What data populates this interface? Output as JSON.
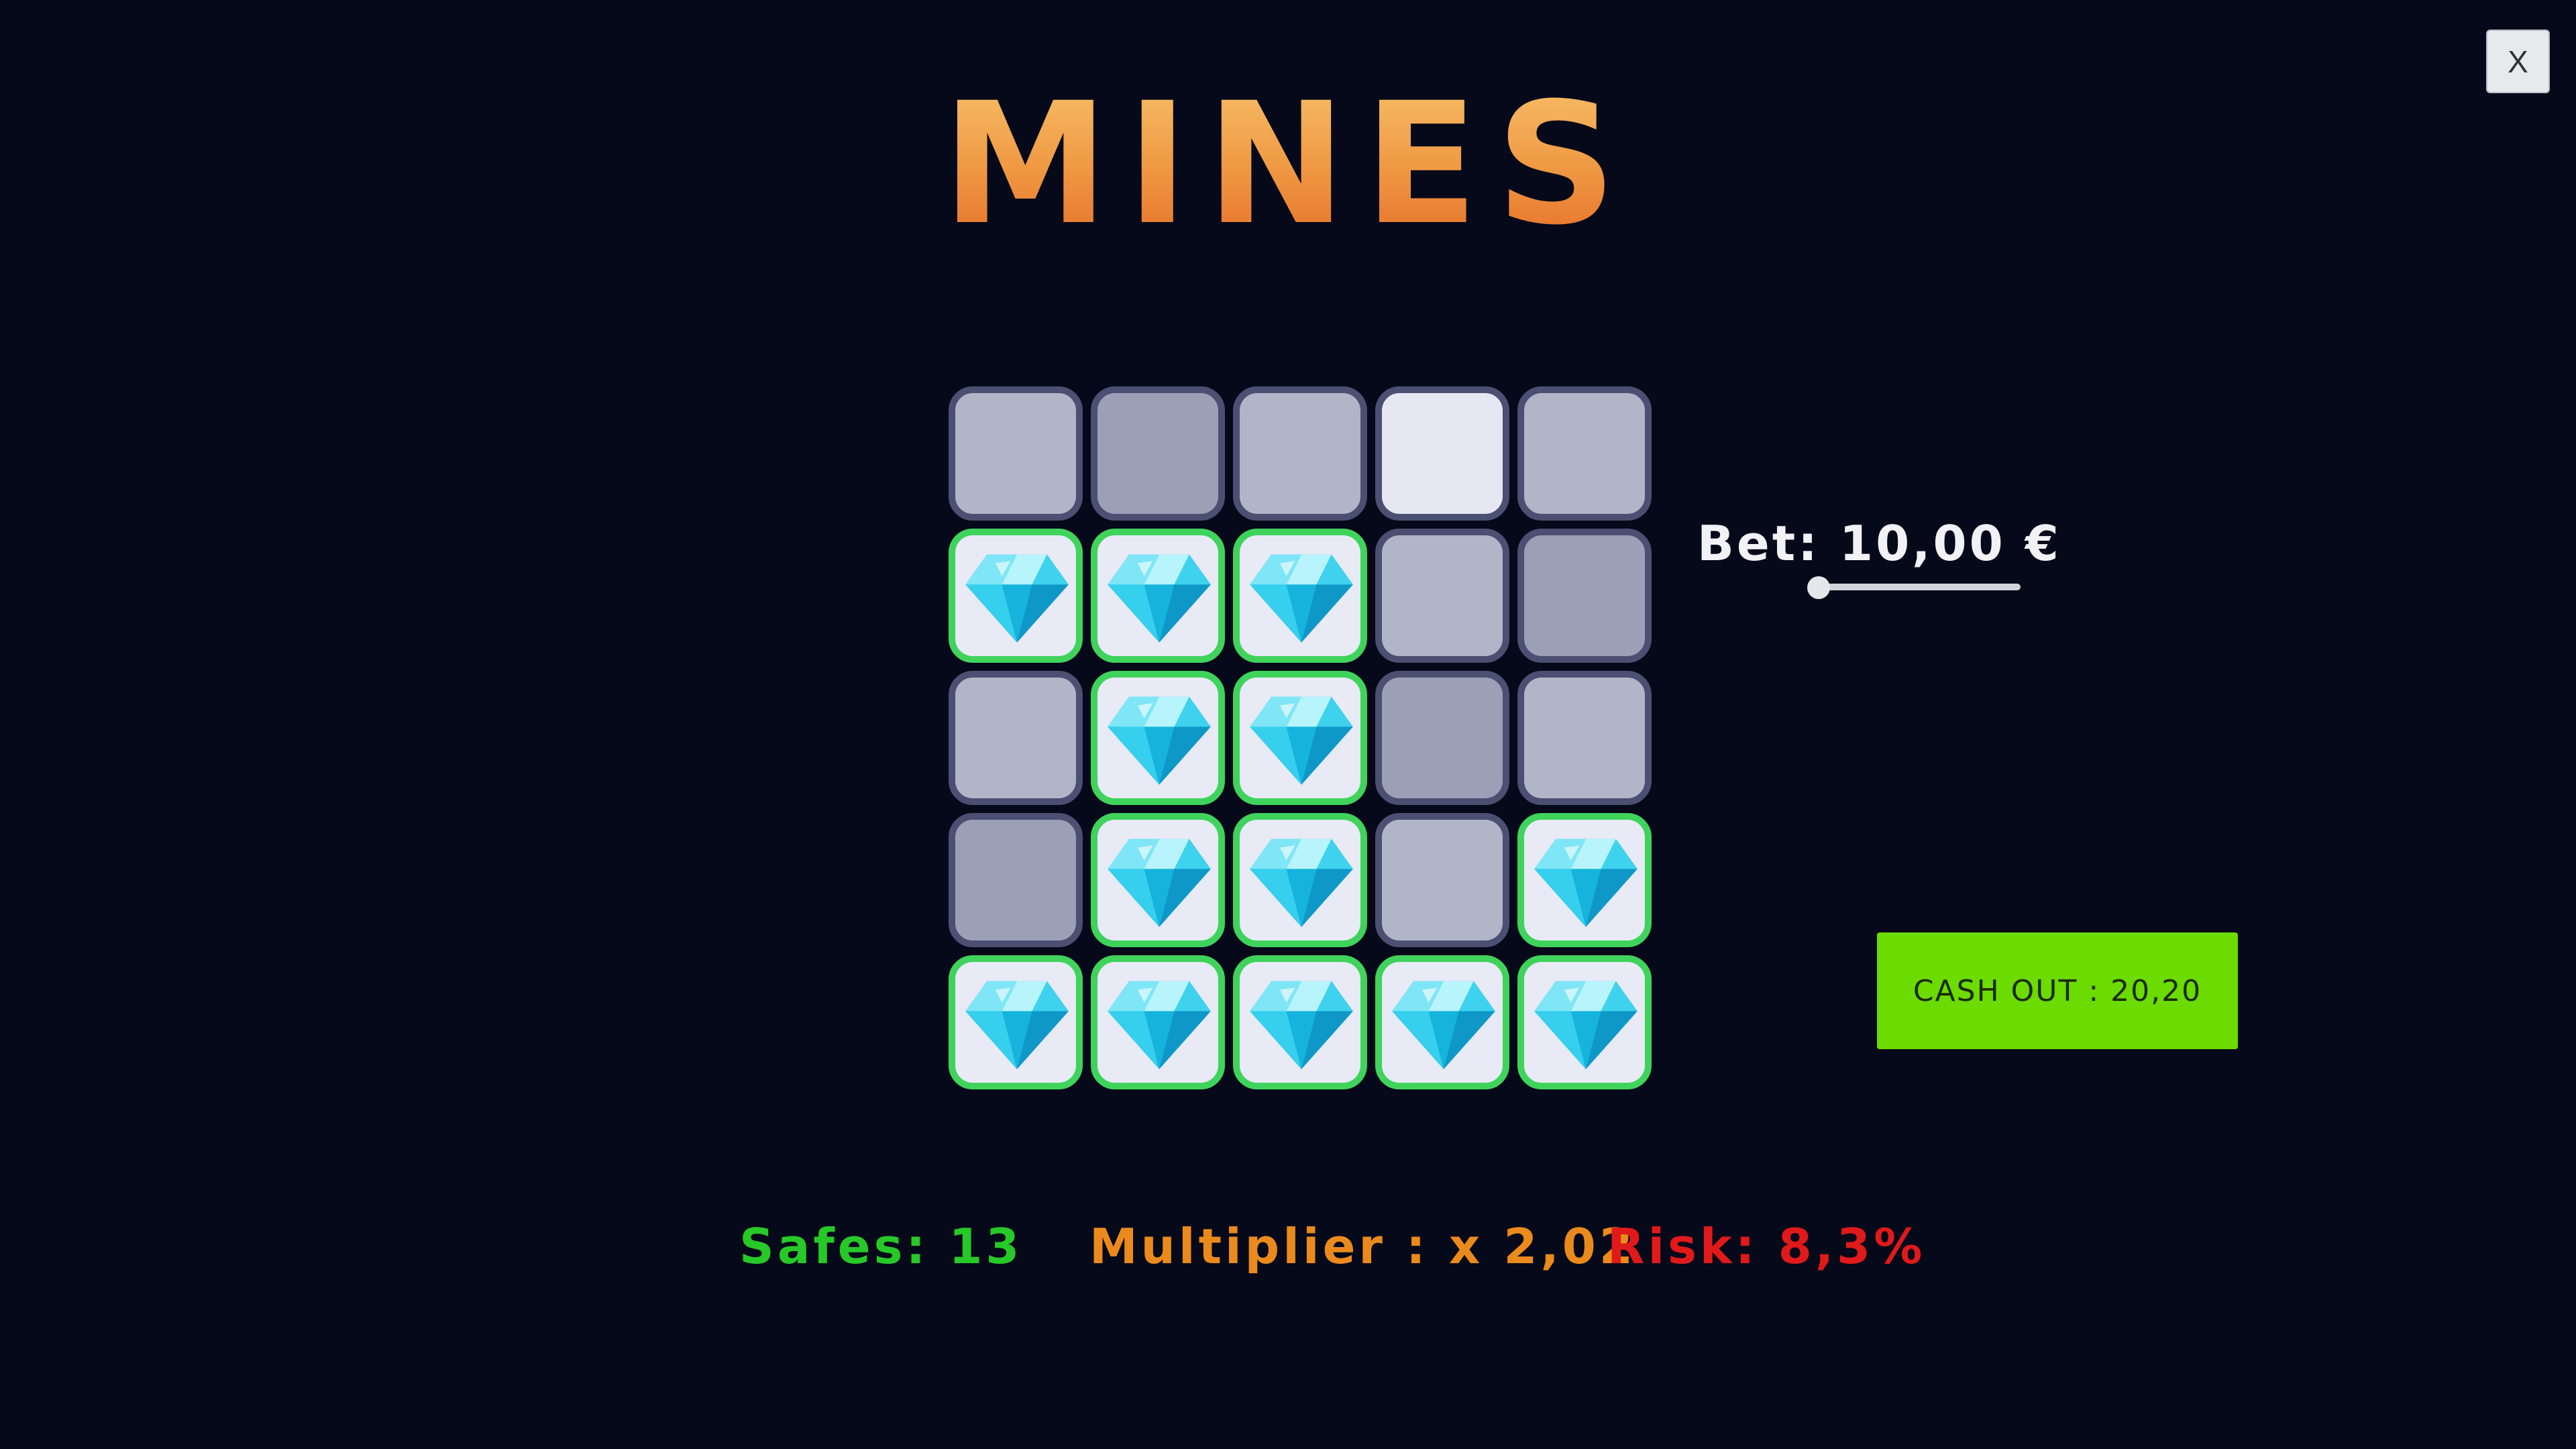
{
  "header": {
    "title": "MINES",
    "close_label": "X"
  },
  "board": {
    "rows": 5,
    "cols": 5,
    "tiles": [
      [
        "hidden-light",
        "hidden-dark",
        "hidden-light",
        "hidden-hover",
        "hidden-light"
      ],
      [
        "gem",
        "gem",
        "gem",
        "hidden-light",
        "hidden-dark"
      ],
      [
        "hidden-light",
        "gem",
        "gem",
        "hidden-dark",
        "hidden-light"
      ],
      [
        "hidden-dark",
        "gem",
        "gem",
        "hidden-light",
        "gem"
      ],
      [
        "gem",
        "gem",
        "gem",
        "gem",
        "gem"
      ]
    ],
    "gem_icon": "diamond-icon"
  },
  "bet": {
    "label": "Bet: 10,00 €",
    "slider_level": 0.0
  },
  "cashout": {
    "label": "CASH OUT : 20,20"
  },
  "stats": {
    "safes": "Safes: 13",
    "multiplier": "Multiplier : x 2,02",
    "risk": "Risk: 8,3%"
  },
  "colors": {
    "background": "#060919",
    "gem_border": "#3fd35c",
    "cashout_bg": "#6bdb00",
    "safes": "#27c928",
    "multiplier": "#eb8a1c",
    "risk": "#e0191a"
  }
}
